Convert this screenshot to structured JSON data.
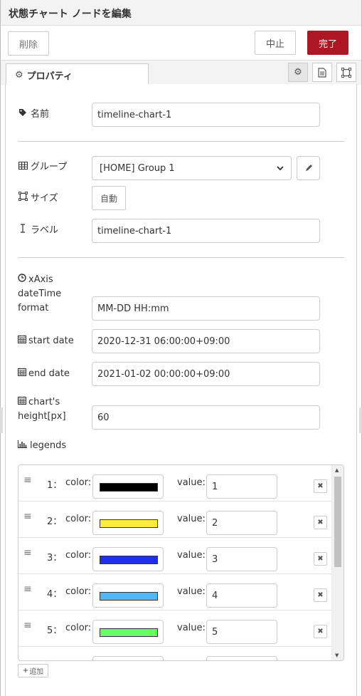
{
  "dialog": {
    "title": "状態チャート ノードを編集",
    "delete_label": "削除",
    "cancel_label": "中止",
    "done_label": "完了"
  },
  "tabs": {
    "properties_label": "プロパティ",
    "icons": [
      "gear-icon",
      "description-icon",
      "appearance-icon"
    ]
  },
  "form": {
    "name_label": "名前",
    "name_value": "timeline-chart-1",
    "group_label": "グループ",
    "group_value": "[HOME] Group 1",
    "size_label": "サイズ",
    "size_button": "自動",
    "label_label": "ラベル",
    "label_value": "timeline-chart-1",
    "xaxis_label_1": "xAxis",
    "xaxis_label_2": "dateTime",
    "xaxis_label_3": "format",
    "xaxis_value": "MM-DD HH:mm",
    "start_label": "start date",
    "start_value": "2020-12-31 06:00:00+09:00",
    "end_label": "end date",
    "end_value": "2021-01-02 00:00:00+09:00",
    "height_label_1": "chart's",
    "height_label_2": "height[px]",
    "height_value": "60",
    "legends_label": "legends"
  },
  "legend_rows": [
    {
      "num": "1：",
      "color_label": "color:",
      "color": "#000000",
      "value_label": "value:",
      "value": "1"
    },
    {
      "num": "2：",
      "color_label": "color:",
      "color": "#ffeb3b",
      "value_label": "value:",
      "value": "2"
    },
    {
      "num": "3：",
      "color_label": "color:",
      "color": "#1e2ff0",
      "value_label": "value:",
      "value": "3"
    },
    {
      "num": "4：",
      "color_label": "color:",
      "color": "#4db8f5",
      "value_label": "value:",
      "value": "4"
    },
    {
      "num": "5：",
      "color_label": "color:",
      "color": "#66ff66",
      "value_label": "value:",
      "value": "5"
    }
  ],
  "add_label": "追加",
  "colors": {
    "done_button": "#ad1625",
    "border": "#cccccc"
  }
}
